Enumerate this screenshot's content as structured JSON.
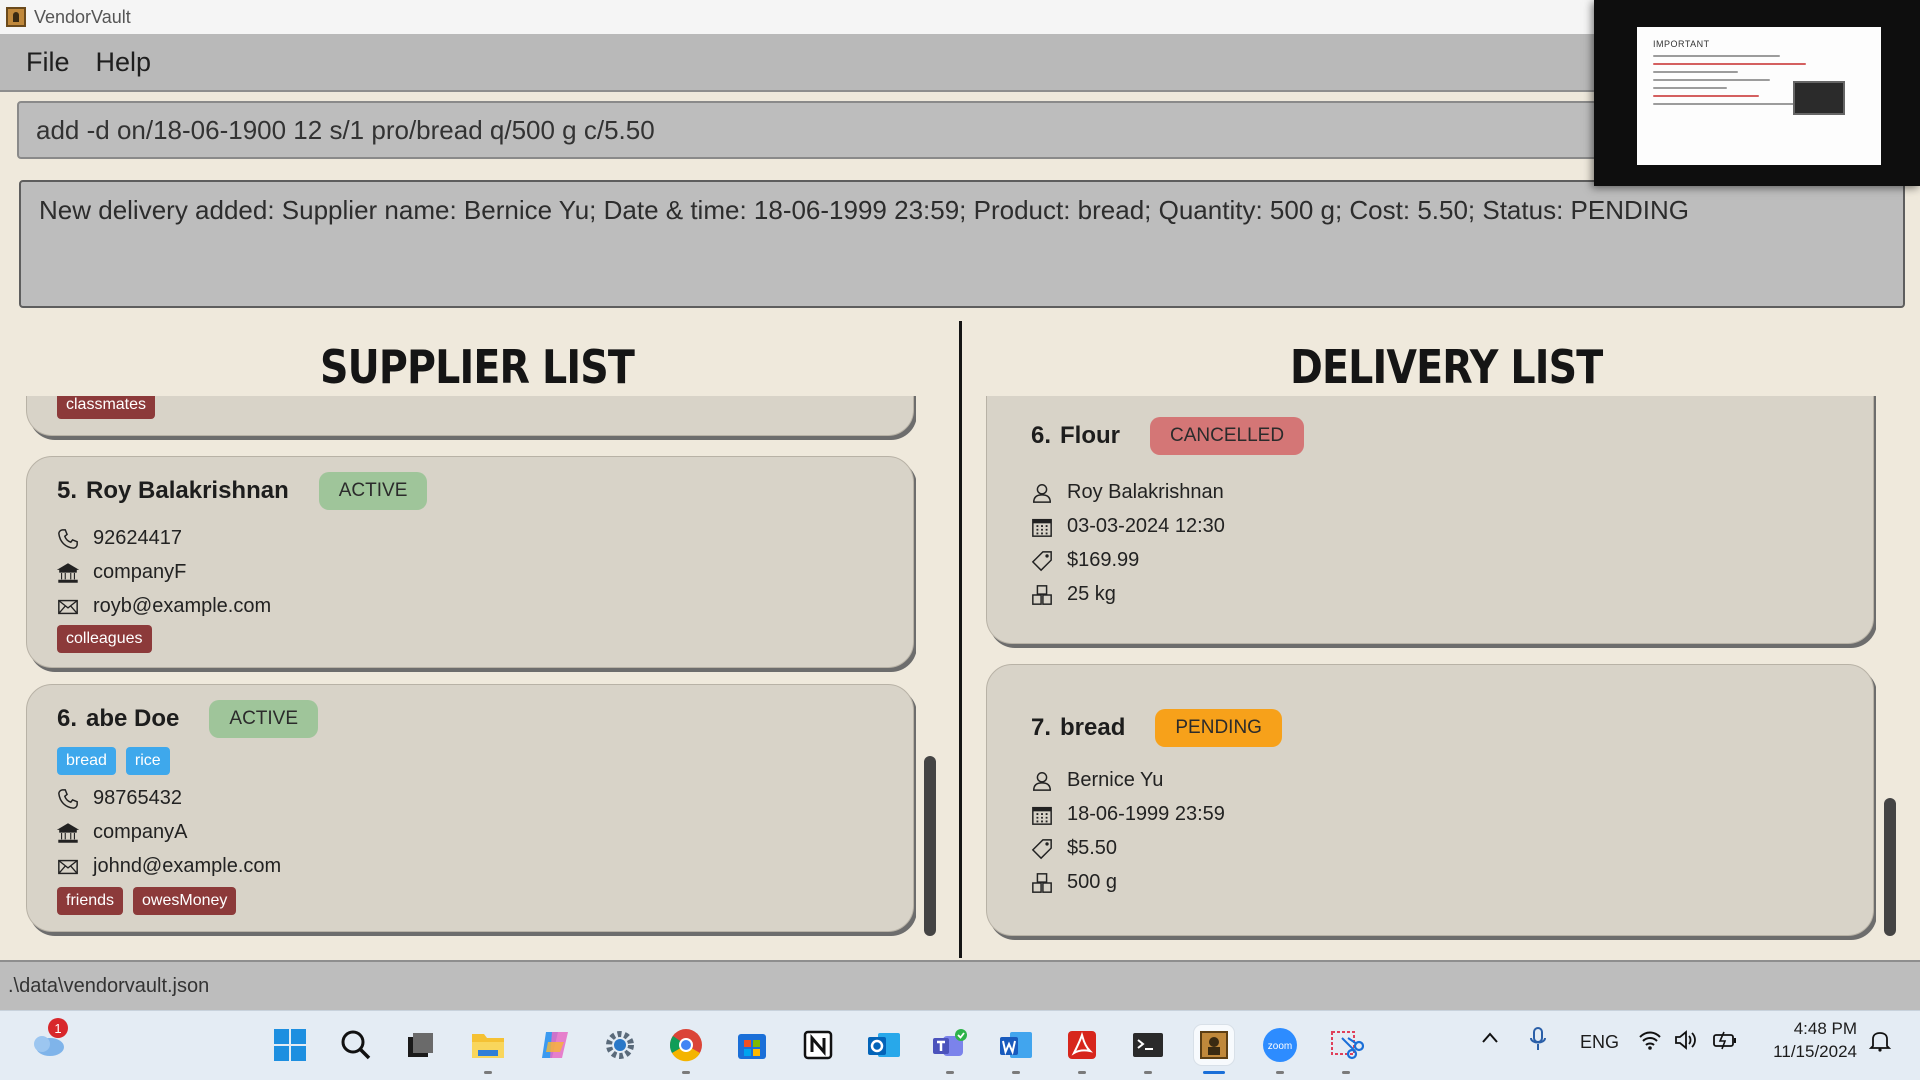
{
  "window": {
    "title": "VendorVault"
  },
  "menu": {
    "items": [
      "File",
      "Help"
    ]
  },
  "command": {
    "value": "add -d on/18-06-1900 12 s/1 pro/bread q/500 g c/5.50"
  },
  "result": {
    "text": "New delivery added: Supplier name: Bernice Yu; Date & time: 18-06-1999 23:59; Product: bread; Quantity: 500 g; Cost: 5.50; Status: PENDING"
  },
  "thumbnail": {
    "heading": "IMPORTANT"
  },
  "suppliers": {
    "title": "SUPPLIER LIST",
    "partial_tags": [
      "classmates"
    ],
    "cards": [
      {
        "index": "5.",
        "name": "Roy Balakrishnan",
        "status": "ACTIVE",
        "products": [],
        "phone": "92624417",
        "company": "companyF",
        "email": "royb@example.com",
        "tags": [
          "colleagues"
        ]
      },
      {
        "index": "6.",
        "name": "abe Doe",
        "status": "ACTIVE",
        "products": [
          "bread",
          "rice"
        ],
        "phone": "98765432",
        "company": "companyA",
        "email": "johnd@example.com",
        "tags": [
          "friends",
          "owesMoney"
        ]
      }
    ]
  },
  "deliveries": {
    "title": "DELIVERY LIST",
    "cards": [
      {
        "index": "6.",
        "product": "Flour",
        "status": "CANCELLED",
        "supplier": "Roy Balakrishnan",
        "datetime": "03-03-2024 12:30",
        "cost": "$169.99",
        "quantity": "25 kg"
      },
      {
        "index": "7.",
        "product": "bread",
        "status": "PENDING",
        "supplier": "Bernice Yu",
        "datetime": "18-06-1999 23:59",
        "cost": "$5.50",
        "quantity": "500 g"
      }
    ]
  },
  "statusbar": {
    "path": ".\\data\\vendorvault.json"
  },
  "taskbar": {
    "notification_count": "1",
    "apps": [
      "weather-icon",
      "start-icon",
      "search-icon",
      "task-view-icon",
      "file-explorer-icon",
      "copilot-icon",
      "settings-icon",
      "chrome-icon",
      "store-icon",
      "notion-icon",
      "outlook-icon",
      "teams-icon",
      "word-icon",
      "acrobat-icon",
      "terminal-icon",
      "vendorvault-icon",
      "zoom-icon",
      "snipping-tool-icon"
    ],
    "language": "ENG",
    "time": "4:48 PM",
    "date": "11/15/2024",
    "zoom_label": "zoom"
  },
  "colors": {
    "active": "#9fc59a",
    "cancelled": "#d47676",
    "pending": "#f7a11a",
    "tag": "#8c3a3a",
    "product_tag": "#3ea8ec",
    "accent": "#1a6fd8"
  }
}
